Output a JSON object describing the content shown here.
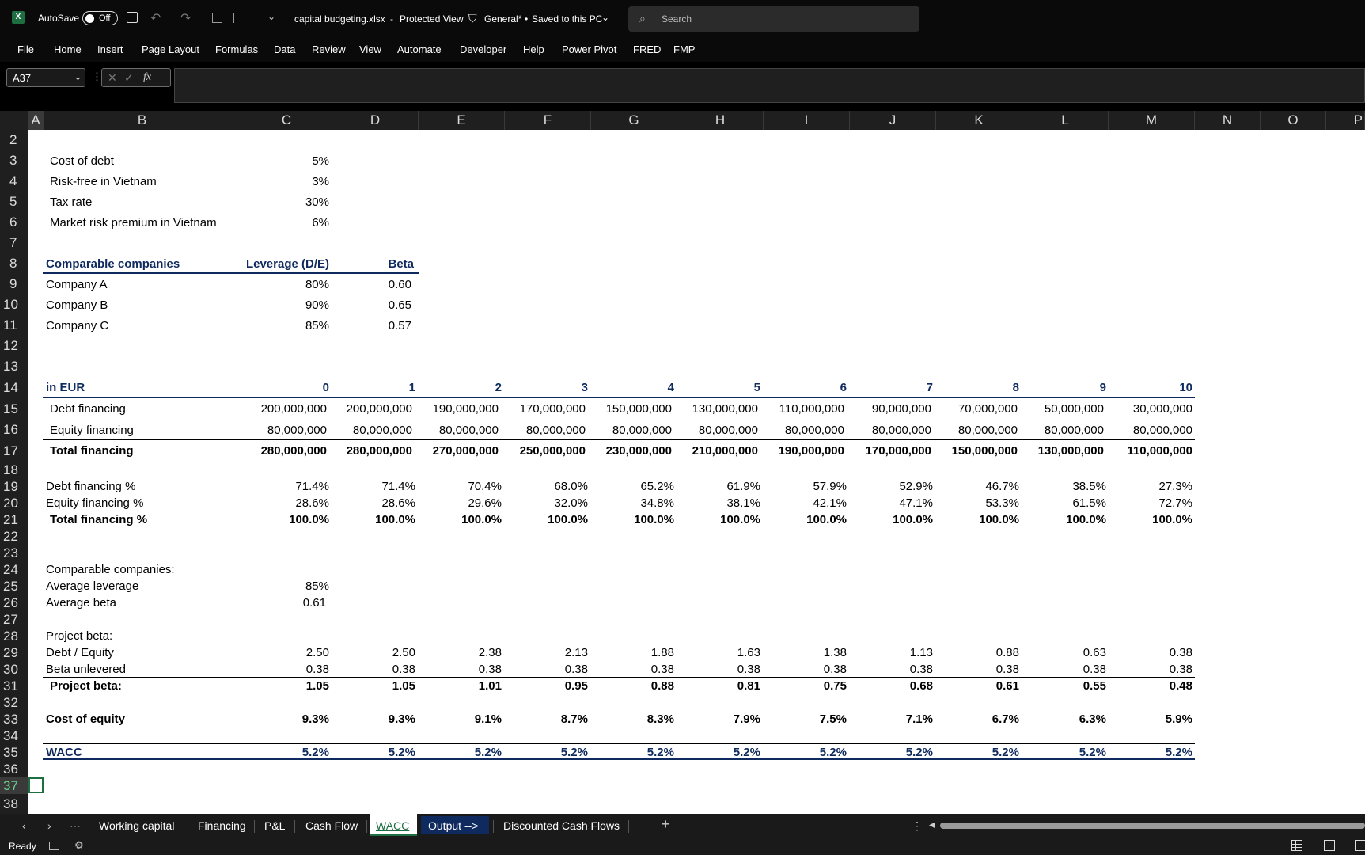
{
  "titlebar": {
    "autosave_label": "AutoSave",
    "autosave_state": "Off",
    "filename": "capital budgeting.xlsx",
    "separator": "-",
    "view_mode": "Protected View",
    "sensitivity": "General*",
    "dot": "•",
    "save_status": "Saved to this PC",
    "search_placeholder": "Search"
  },
  "menu": [
    "File",
    "Home",
    "Insert",
    "Page Layout",
    "Formulas",
    "Data",
    "Review",
    "View",
    "Automate",
    "Developer",
    "Help",
    "Power Pivot",
    "FRED",
    "FMP"
  ],
  "formula_bar": {
    "name_box": "A37",
    "fx": "fx",
    "formula": ""
  },
  "columns": [
    "A",
    "B",
    "C",
    "D",
    "E",
    "F",
    "G",
    "H",
    "I",
    "J",
    "K",
    "L",
    "M",
    "N",
    "O",
    "P"
  ],
  "rows": [
    "2",
    "3",
    "4",
    "5",
    "6",
    "7",
    "8",
    "9",
    "10",
    "11",
    "12",
    "13",
    "14",
    "15",
    "16",
    "17",
    "18",
    "19",
    "20",
    "21",
    "22",
    "23",
    "24",
    "25",
    "26",
    "27",
    "28",
    "29",
    "30",
    "31",
    "32",
    "33",
    "34",
    "35",
    "36",
    "37",
    "38"
  ],
  "inputs": [
    {
      "label": "Cost of debt",
      "value": "5%"
    },
    {
      "label": "Risk-free in Vietnam",
      "value": "3%"
    },
    {
      "label": "Tax rate",
      "value": "30%"
    },
    {
      "label": "Market risk premium in Vietnam",
      "value": "6%"
    }
  ],
  "comps": {
    "headers": [
      "Comparable companies",
      "Leverage (D/E)",
      "Beta"
    ],
    "rows": [
      [
        "Company A",
        "80%",
        "0.60"
      ],
      [
        "Company B",
        "90%",
        "0.65"
      ],
      [
        "Company C",
        "85%",
        "0.57"
      ]
    ]
  },
  "financing": {
    "unit_label": "in EUR",
    "years": [
      "0",
      "1",
      "2",
      "3",
      "4",
      "5",
      "6",
      "7",
      "8",
      "9",
      "10"
    ],
    "debt_label": "Debt financing",
    "debt": [
      "200,000,000",
      "200,000,000",
      "190,000,000",
      "170,000,000",
      "150,000,000",
      "130,000,000",
      "110,000,000",
      "90,000,000",
      "70,000,000",
      "50,000,000",
      "30,000,000"
    ],
    "equity_label": "Equity financing",
    "equity": [
      "80,000,000",
      "80,000,000",
      "80,000,000",
      "80,000,000",
      "80,000,000",
      "80,000,000",
      "80,000,000",
      "80,000,000",
      "80,000,000",
      "80,000,000",
      "80,000,000"
    ],
    "total_label": "Total financing",
    "total": [
      "280,000,000",
      "280,000,000",
      "270,000,000",
      "250,000,000",
      "230,000,000",
      "210,000,000",
      "190,000,000",
      "170,000,000",
      "150,000,000",
      "130,000,000",
      "110,000,000"
    ]
  },
  "pct": {
    "debt_label": "Debt financing %",
    "debt": [
      "71.4%",
      "71.4%",
      "70.4%",
      "68.0%",
      "65.2%",
      "61.9%",
      "57.9%",
      "52.9%",
      "46.7%",
      "38.5%",
      "27.3%"
    ],
    "equity_label": "Equity financing %",
    "equity": [
      "28.6%",
      "28.6%",
      "29.6%",
      "32.0%",
      "34.8%",
      "38.1%",
      "42.1%",
      "47.1%",
      "53.3%",
      "61.5%",
      "72.7%"
    ],
    "total_label": "Total financing %",
    "total": [
      "100.0%",
      "100.0%",
      "100.0%",
      "100.0%",
      "100.0%",
      "100.0%",
      "100.0%",
      "100.0%",
      "100.0%",
      "100.0%",
      "100.0%"
    ]
  },
  "averages": {
    "heading": "Comparable companies:",
    "lev_label": "Average leverage",
    "lev": "85%",
    "beta_label": "Average beta",
    "beta": "0.61"
  },
  "project": {
    "heading": "Project beta:",
    "de_label": "Debt / Equity",
    "de": [
      "2.50",
      "2.50",
      "2.38",
      "2.13",
      "1.88",
      "1.63",
      "1.38",
      "1.13",
      "0.88",
      "0.63",
      "0.38"
    ],
    "bu_label": "Beta unlevered",
    "bu": [
      "0.38",
      "0.38",
      "0.38",
      "0.38",
      "0.38",
      "0.38",
      "0.38",
      "0.38",
      "0.38",
      "0.38",
      "0.38"
    ],
    "pb_label": "Project beta:",
    "pb": [
      "1.05",
      "1.05",
      "1.01",
      "0.95",
      "0.88",
      "0.81",
      "0.75",
      "0.68",
      "0.61",
      "0.55",
      "0.48"
    ],
    "coe_label": "Cost of equity",
    "coe": [
      "9.3%",
      "9.3%",
      "9.1%",
      "8.7%",
      "8.3%",
      "7.9%",
      "7.5%",
      "7.1%",
      "6.7%",
      "6.3%",
      "5.9%"
    ],
    "wacc_label": "WACC",
    "wacc": [
      "5.2%",
      "5.2%",
      "5.2%",
      "5.2%",
      "5.2%",
      "5.2%",
      "5.2%",
      "5.2%",
      "5.2%",
      "5.2%",
      "5.2%"
    ]
  },
  "tabs": [
    "Working capital",
    "Financing",
    "P&L",
    "Cash Flow",
    "WACC",
    "Output -->",
    "Discounted Cash Flows"
  ],
  "status": {
    "ready": "Ready"
  }
}
